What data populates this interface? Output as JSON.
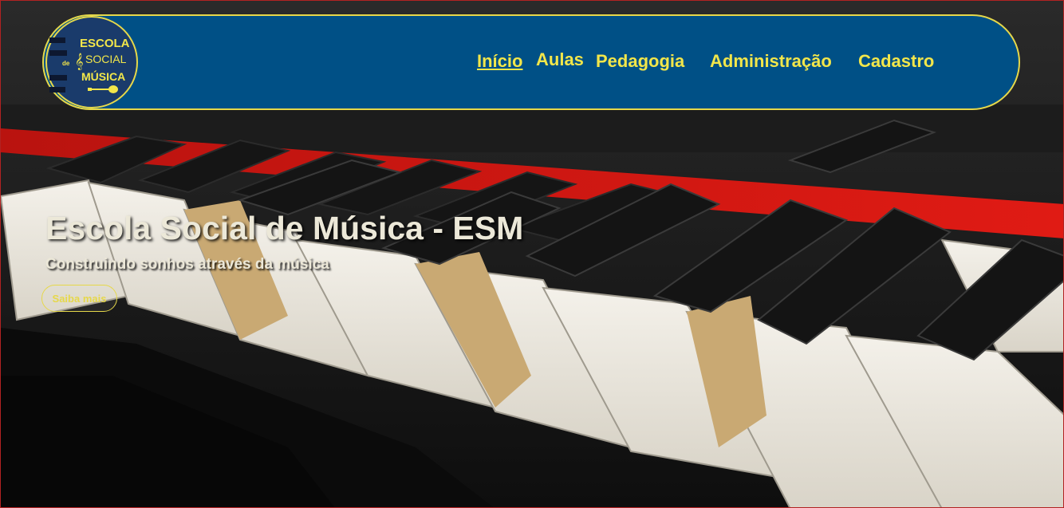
{
  "header": {
    "logo": {
      "line1": "ESCOLA",
      "line2_prefix": "de",
      "line2": "SOCIAL",
      "line3": "MÚSICA",
      "colors": {
        "ring": "#e6d84a",
        "bg": "#1a3b6b",
        "text": "#f2e64a"
      }
    },
    "nav": [
      {
        "label": "Início",
        "active": true
      },
      {
        "label": "Aulas",
        "active": false
      },
      {
        "label": "Pedagogia",
        "active": false
      },
      {
        "label": "Administração",
        "active": false
      },
      {
        "label": "Cadastro",
        "active": false
      }
    ]
  },
  "hero": {
    "title": "Escola Social de Música - ESM",
    "subtitle": "Construindo sonhos através da música",
    "cta_label": "Saiba mais",
    "background": "piano-keys-photo"
  },
  "colors": {
    "navbar_bg": "#005086",
    "accent": "#e6d84a",
    "nav_text": "#f2e64a",
    "hero_text": "#ece8d8"
  }
}
